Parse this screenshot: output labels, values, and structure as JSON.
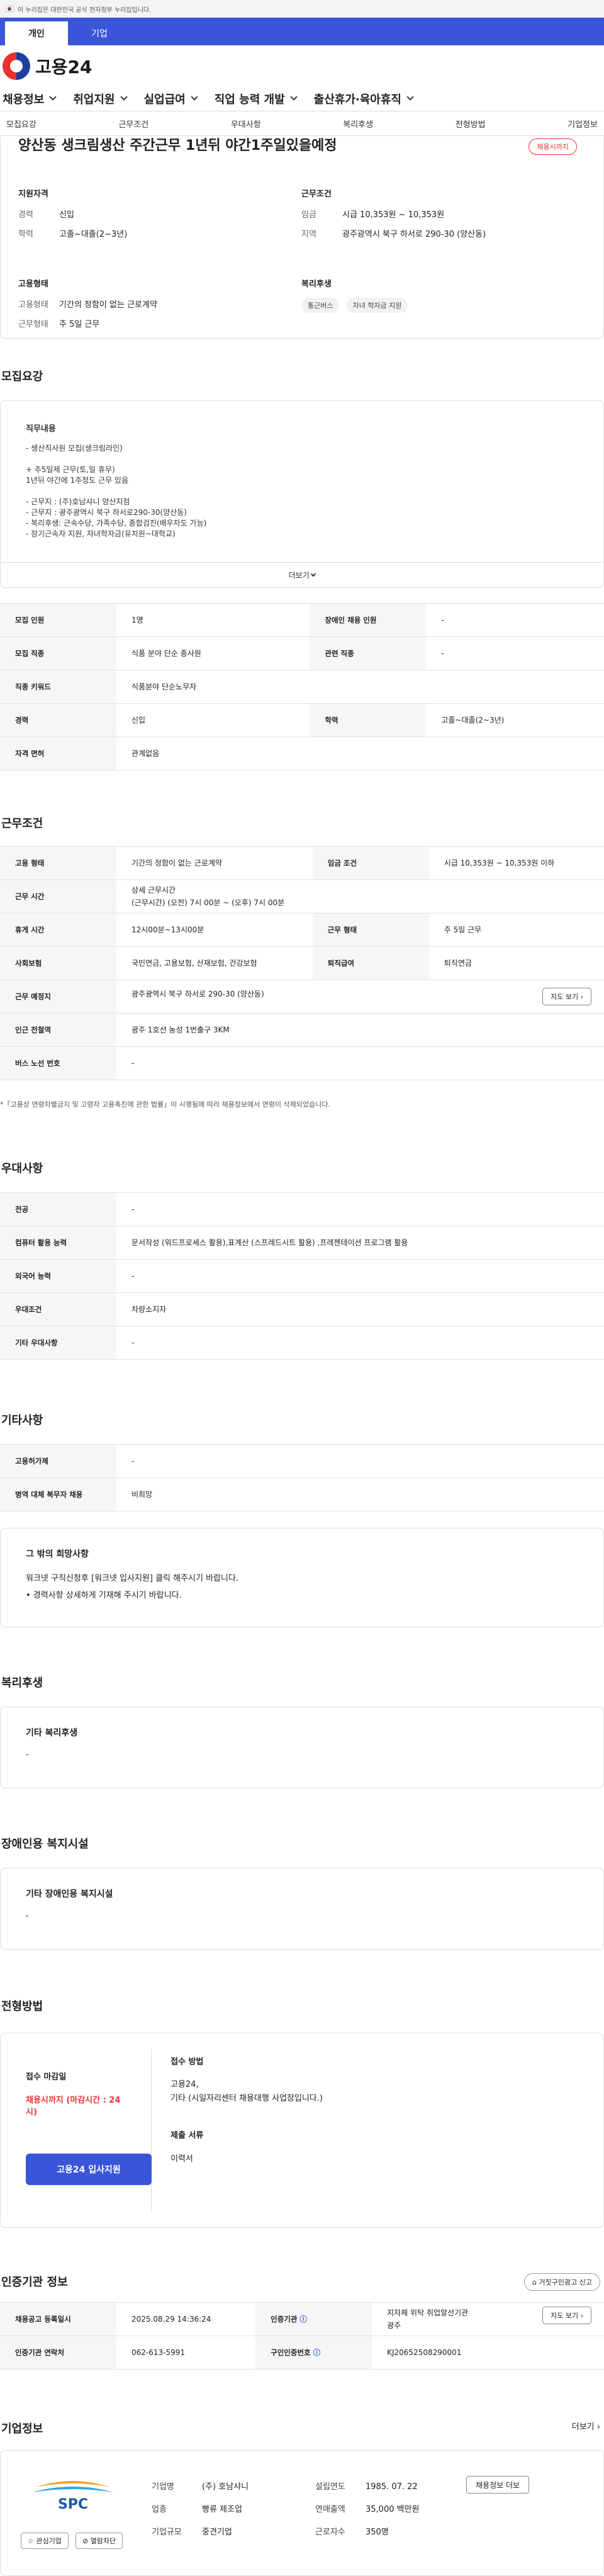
{
  "gov_banner": "이 누리집은 대한민국 공식 전자정부 누리집입니다.",
  "tabs": [
    "개인",
    "기업"
  ],
  "logo": "고용24",
  "mainnav": [
    "채용정보",
    "취업지원",
    "실업급여",
    "직업 능력 개발",
    "출산휴가·육아휴직"
  ],
  "subnav": [
    "모집요강",
    "근무조건",
    "우대사항",
    "복리후생",
    "전형방법",
    "기업정보"
  ],
  "summary": {
    "title": "양산동 생크림생산 주간근무 1년뒤 야간1주일있을예정",
    "badge": "채용시까지",
    "qual_title": "지원자격",
    "qual": [
      {
        "k": "경력",
        "v": "신입"
      },
      {
        "k": "학력",
        "v": "고졸~대졸(2~3년)"
      }
    ],
    "work_title": "근무조건",
    "work": [
      {
        "k": "임금",
        "v": "시급 10,353원 ~ 10,353원"
      },
      {
        "k": "지역",
        "v": "광주광역시 북구 하서로 290-30 (양산동)"
      }
    ],
    "emp_title": "고용형태",
    "emp": [
      {
        "k": "고용형태",
        "v": "기간의 정함이 없는 근로계약"
      },
      {
        "k": "근무형태",
        "v": "주 5일 근무"
      }
    ],
    "welfare_title": "복리후생",
    "welfare_chips": [
      "통근버스",
      "자녀 학자금 지원"
    ]
  },
  "recruit": {
    "section": "모집요강",
    "box_title": "직무내용",
    "text": "- 생산직사원 모집(생크림라인)\n\n+ 주5일제 근무(토,일 휴무)\n  1년뒤 야간에 1주정도 근무 있음\n\n- 근무지 : (주)호남샤니 양산지점\n- 근무지 : 광주광역시 북구 하서로290-30(양산동)\n- 복리후생: 근속수당, 가족수당, 종합검진(배우자도 가능)\n- 장기근속자 지원, 자녀학자금(유치원~대학교)",
    "more": "더보기"
  },
  "recruit_table": [
    [
      {
        "h": "모집 인원"
      },
      {
        "v": "1명"
      },
      {
        "h": "장애인 채용 인원"
      },
      {
        "v": "-"
      }
    ],
    [
      {
        "h": "모집 직종"
      },
      {
        "v": "식품 분야 단순 종사원"
      },
      {
        "h": "관련 직종"
      },
      {
        "v": "-"
      }
    ],
    [
      {
        "h": "직종 키워드"
      },
      {
        "v": "식품분야 단순노무자",
        "span": 3
      }
    ],
    [
      {
        "h": "경력"
      },
      {
        "v": "신입"
      },
      {
        "h": "학력"
      },
      {
        "v": "고졸~대졸(2~3년)"
      }
    ],
    [
      {
        "h": "자격 면허"
      },
      {
        "v": "관계없음",
        "span": 3
      }
    ]
  ],
  "work": {
    "section": "근무조건",
    "rows": [
      [
        {
          "h": "고용 형태"
        },
        {
          "v": "기간의 정함이 없는 근로계약"
        },
        {
          "h": "임금 조건"
        },
        {
          "v": "시급 10,353원 ~ 10,353원 이하"
        }
      ],
      [
        {
          "h": "근무 시간"
        },
        {
          "v": "상세 근무시간\n(근무시간) (오전) 7시 00분 ~ (오후) 7시 00분",
          "span": 3
        }
      ],
      [
        {
          "h": "휴게 시간"
        },
        {
          "v": "12시00분~13시00분"
        },
        {
          "h": "근무 형태"
        },
        {
          "v": "주 5일 근무"
        }
      ],
      [
        {
          "h": "사회보험"
        },
        {
          "v": "국민연금, 고용보험, 산재보험, 건강보험"
        },
        {
          "h": "퇴직급여"
        },
        {
          "v": "퇴직연금"
        }
      ],
      [
        {
          "h": "근무 예정지"
        },
        {
          "v": "광주광역시 북구 하서로 290-30 (양산동)",
          "span": 3,
          "btn": "지도 보기"
        }
      ],
      [
        {
          "h": "인근 전철역"
        },
        {
          "v": "광주 1호선 농성 1번출구 3KM",
          "span": 3
        }
      ],
      [
        {
          "h": "버스 노선 번호"
        },
        {
          "v": "-",
          "span": 3
        }
      ]
    ],
    "note": "*「고용상 연령차별금지 및 고령자 고용촉진에 관한 법률」이 시행됨에 따라 채용정보에서 연령이 삭제되었습니다."
  },
  "pref": {
    "section": "우대사항",
    "rows": [
      [
        {
          "h": "전공"
        },
        {
          "v": "-"
        }
      ],
      [
        {
          "h": "컴퓨터 활용 능력"
        },
        {
          "v": "문서작성 (워드프로세스 활용),표계산 (스프레드시트 활용) ,프레젠테이션 프로그램 활용"
        }
      ],
      [
        {
          "h": "외국어 능력"
        },
        {
          "v": "-"
        }
      ],
      [
        {
          "h": "우대조건"
        },
        {
          "v": "차량소지자"
        }
      ],
      [
        {
          "h": "기타 우대사항"
        },
        {
          "v": "-"
        }
      ]
    ]
  },
  "etc": {
    "section": "기타사항",
    "rows": [
      [
        {
          "h": "고용허가제"
        },
        {
          "v": "-"
        }
      ],
      [
        {
          "h": "병역 대체 복무자 채용"
        },
        {
          "v": "비희망"
        }
      ]
    ],
    "wish_title": "그 밖의 희망사항",
    "wish_lines": [
      "워크넷 구직신청후 [워크넷 입사지원] 클릭 해주시기 바랍니다.",
      "• 경력사항 상세하게 기재해 주시기 바랍니다."
    ]
  },
  "welfare": {
    "section": "복리후생",
    "title": "기타 복리후생",
    "value": "-"
  },
  "disabled": {
    "section": "장애인용 복지시설",
    "title": "기타 장애인용 복지시설",
    "value": "-"
  },
  "selection": {
    "section": "전형방법",
    "deadline_label": "접수 마감일",
    "deadline": "채용시까지 (마감시간 : 24시)",
    "apply_btn": "고용24 입사지원",
    "method_label": "접수 방법",
    "method": "고용24,\n기타 (시일자리센터 채용대행 사업장입니다.)",
    "docs_label": "제출 서류",
    "docs": "이력서"
  },
  "cert": {
    "section": "인증기관 정보",
    "report_btn": "거짓구인광고 신고",
    "rows": [
      [
        {
          "h": "채용공고 등록일시"
        },
        {
          "v": "2025.08.29 14:36:24"
        },
        {
          "h": "인증기관",
          "info": true
        },
        {
          "v": "지자체 위탁 취업알선기관\n광주",
          "btn": "지도 보기"
        }
      ],
      [
        {
          "h": "인증기관 연락처"
        },
        {
          "v": "062-613-5991"
        },
        {
          "h": "구인인증번호",
          "info": true
        },
        {
          "v": "KJ20652508290001"
        }
      ]
    ]
  },
  "company": {
    "section": "기업정보",
    "more": "더보기",
    "logo_text": "SPC",
    "rows": [
      {
        "k": "기업명",
        "v": "(주) 호남샤니",
        "k2": "설립연도",
        "v2": "1985. 07. 22"
      },
      {
        "k": "업종",
        "v": "빵류 제조업",
        "k2": "연매출액",
        "v2": "35,000 백만원"
      },
      {
        "k": "기업규모",
        "v": "중견기업",
        "k2": "근로자수",
        "v2": "350명"
      }
    ],
    "btn_jobs": "채용정보 더보",
    "btn_fav": "관심기업",
    "btn_block": "열람차단"
  }
}
